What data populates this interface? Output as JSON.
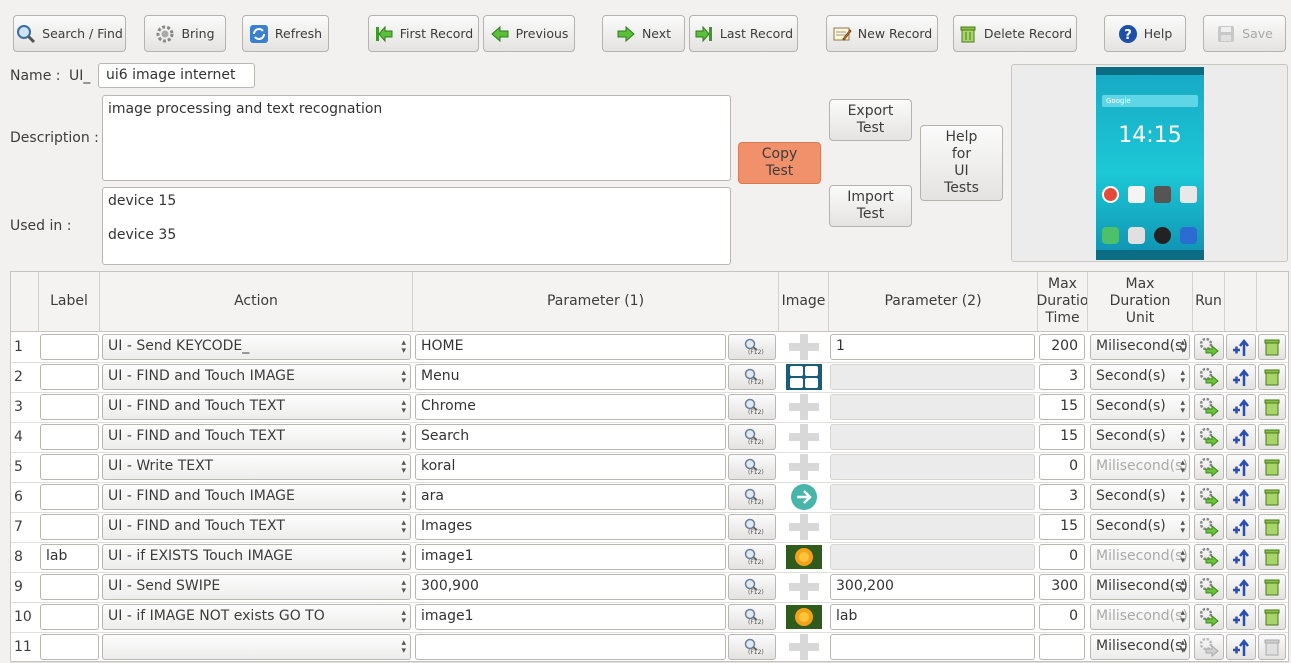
{
  "toolbar": {
    "search": "Search / Find",
    "bring": "Bring",
    "refresh": "Refresh",
    "first": "First Record",
    "previous": "Previous",
    "next": "Next",
    "last": "Last Record",
    "new": "New Record",
    "delete": "Delete Record",
    "help": "Help",
    "save": "Save"
  },
  "form": {
    "name_label": "Name :",
    "name_prefix": "UI_",
    "name_value": "ui6 image internet",
    "description_label": "Description :",
    "description_value": "image processing and text recognation",
    "used_in_label": "Used in :",
    "used_in": [
      "device 15",
      "device 35"
    ],
    "copy_test": "Copy\nTest",
    "export_test": "Export\nTest",
    "import_test": "Import\nTest",
    "help_ui": "Help\nfor\nUI\nTests"
  },
  "phone": {
    "clock": "14:15",
    "search": "Google"
  },
  "table": {
    "headers": {
      "label": "Label",
      "action": "Action",
      "param1": "Parameter (1)",
      "image": "Image",
      "param2": "Parameter (2)",
      "max_time": "Max\nDuratio\nTime",
      "max_unit": "Max\nDuration\nUnit",
      "run": "Run"
    },
    "search_hint": "(F12)",
    "rows": [
      {
        "n": "1",
        "label": "",
        "action": "UI - Send KEYCODE_",
        "p1": "HOME",
        "img": "none",
        "p2": "1",
        "p2dis": false,
        "time": "200",
        "unit": "Milisecond(s)",
        "udim": false
      },
      {
        "n": "2",
        "label": "",
        "action": "UI - FIND and Touch IMAGE",
        "p1": "Menu",
        "img": "menu",
        "p2": "",
        "p2dis": true,
        "time": "3",
        "unit": "Second(s)",
        "udim": false
      },
      {
        "n": "3",
        "label": "",
        "action": "UI - FIND and Touch TEXT",
        "p1": "Chrome",
        "img": "none",
        "p2": "",
        "p2dis": true,
        "time": "15",
        "unit": "Second(s)",
        "udim": false
      },
      {
        "n": "4",
        "label": "",
        "action": "UI - FIND and Touch TEXT",
        "p1": "Search",
        "img": "none",
        "p2": "",
        "p2dis": true,
        "time": "15",
        "unit": "Second(s)",
        "udim": false
      },
      {
        "n": "5",
        "label": "",
        "action": "UI - Write TEXT",
        "p1": "koral",
        "img": "none",
        "p2": "",
        "p2dis": true,
        "time": "0",
        "unit": "Milisecond(s)",
        "udim": true
      },
      {
        "n": "6",
        "label": "",
        "action": "UI - FIND and Touch IMAGE",
        "p1": "ara",
        "img": "arrow",
        "p2": "",
        "p2dis": true,
        "time": "3",
        "unit": "Second(s)",
        "udim": false
      },
      {
        "n": "7",
        "label": "",
        "action": "UI - FIND and Touch TEXT",
        "p1": "Images",
        "img": "none",
        "p2": "",
        "p2dis": true,
        "time": "15",
        "unit": "Second(s)",
        "udim": false
      },
      {
        "n": "8",
        "label": "lab",
        "action": "UI - if EXISTS Touch IMAGE",
        "p1": "image1",
        "img": "flower",
        "p2": "",
        "p2dis": true,
        "time": "0",
        "unit": "Milisecond(s)",
        "udim": true
      },
      {
        "n": "9",
        "label": "",
        "action": "UI - Send SWIPE",
        "p1": "300,900",
        "img": "none",
        "p2": "300,200",
        "p2dis": false,
        "time": "300",
        "unit": "Milisecond(s)",
        "udim": false
      },
      {
        "n": "10",
        "label": "",
        "action": "UI - if IMAGE NOT exists GO TO",
        "p1": "image1",
        "img": "flower",
        "p2": "lab",
        "p2dis": false,
        "time": "0",
        "unit": "Milisecond(s)",
        "udim": true
      },
      {
        "n": "11",
        "label": "",
        "action": "",
        "p1": "",
        "img": "none",
        "p2": "",
        "p2dis": false,
        "time": "",
        "unit": "Milisecond(s)",
        "udim": false
      }
    ]
  },
  "colors": {
    "copy_button": "#f1916b",
    "run_arrow": "#6cc33a",
    "move_arrow": "#2a4fb3",
    "phone_bg": "#1cc8d6"
  }
}
